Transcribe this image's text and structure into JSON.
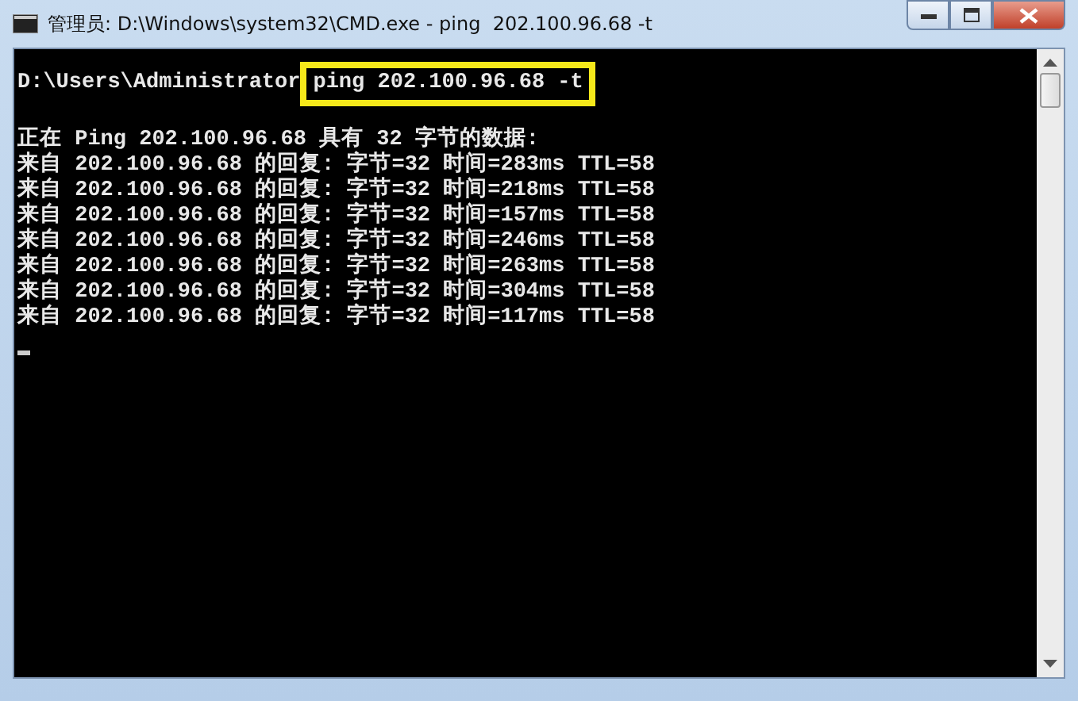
{
  "window": {
    "title": "管理员: D:\\Windows\\system32\\CMD.exe - ping  202.100.96.68 -t"
  },
  "console": {
    "prompt": "D:\\Users\\Administrator",
    "command": "ping 202.100.96.68 -t",
    "command_highlighted": true,
    "lines": [
      "正在 Ping 202.100.96.68 具有 32 字节的数据:",
      "来自 202.100.96.68 的回复: 字节=32 时间=283ms TTL=58",
      "来自 202.100.96.68 的回复: 字节=32 时间=218ms TTL=58",
      "来自 202.100.96.68 的回复: 字节=32 时间=157ms TTL=58",
      "来自 202.100.96.68 的回复: 字节=32 时间=246ms TTL=58",
      "来自 202.100.96.68 的回复: 字节=32 时间=263ms TTL=58",
      "来自 202.100.96.68 的回复: 字节=32 时间=304ms TTL=58",
      "来自 202.100.96.68 的回复: 字节=32 时间=117ms TTL=58"
    ]
  }
}
